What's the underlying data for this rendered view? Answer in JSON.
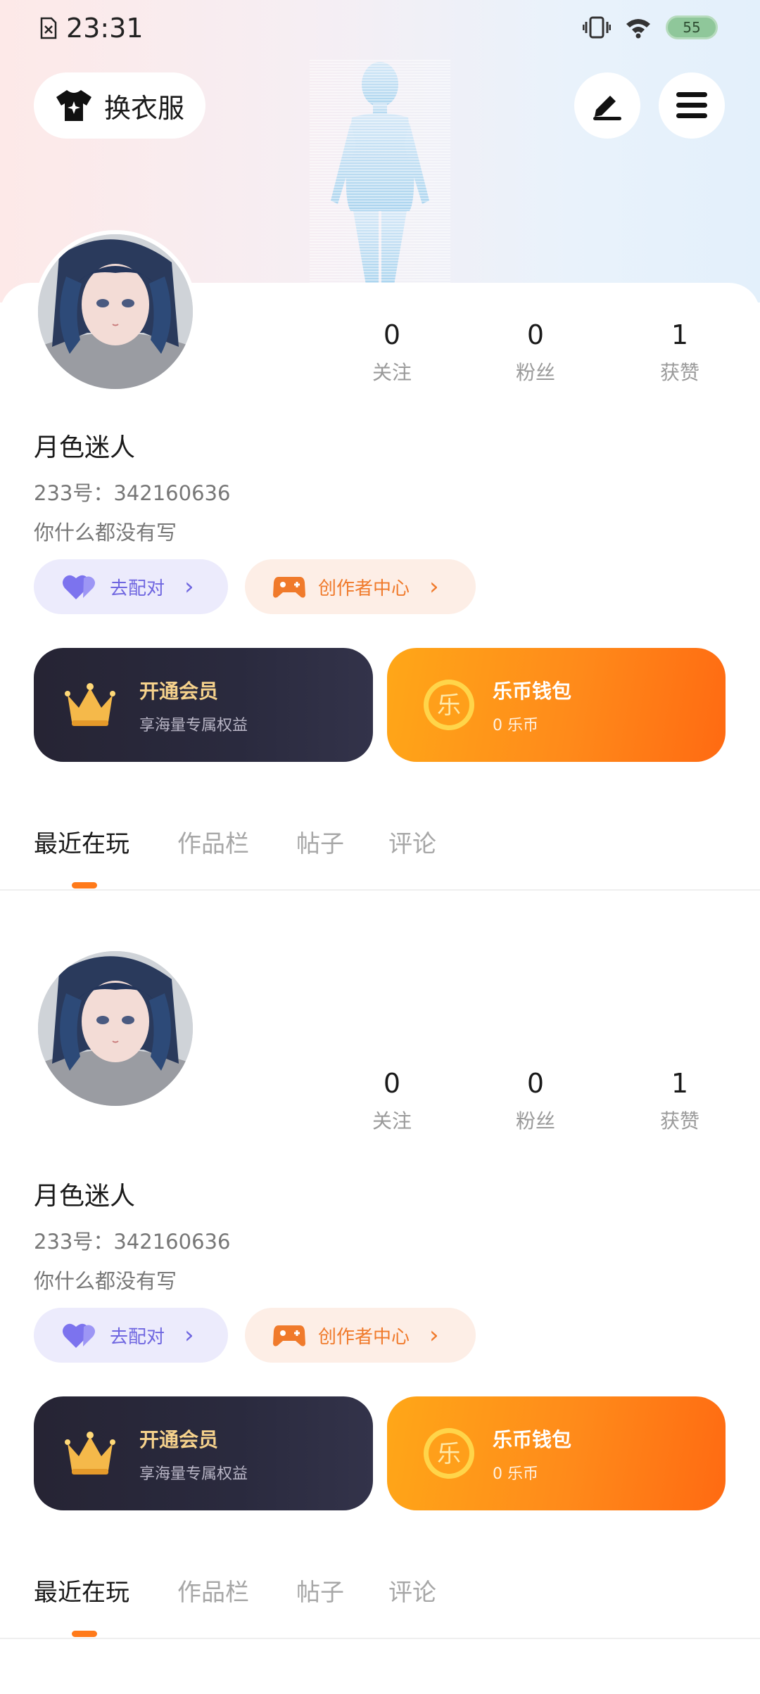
{
  "status_bar": {
    "time": "23:31",
    "battery": "55"
  },
  "header": {
    "outfit_label": "换衣服"
  },
  "profile": {
    "stats": [
      {
        "value": "0",
        "label": "关注"
      },
      {
        "value": "0",
        "label": "粉丝"
      },
      {
        "value": "1",
        "label": "获赞"
      }
    ],
    "username": "月色迷人",
    "uid_label": "233号：",
    "uid_value": "342160636",
    "bio": "你什么都没有写",
    "match_label": "去配对",
    "creator_label": "创作者中心",
    "vip_card": {
      "title": "开通会员",
      "subtitle": "享海量专属权益"
    },
    "coin_card": {
      "title": "乐币钱包",
      "subtitle": "0 乐币",
      "coin_glyph": "乐"
    },
    "tabs": [
      "最近在玩",
      "作品栏",
      "帖子",
      "评论"
    ],
    "active_tab": 0
  },
  "colors": {
    "accent_orange": "#ff7a1a",
    "match_purple": "#6f66e0",
    "vip_dark": "#262434",
    "vip_gold": "#f6d28c"
  }
}
